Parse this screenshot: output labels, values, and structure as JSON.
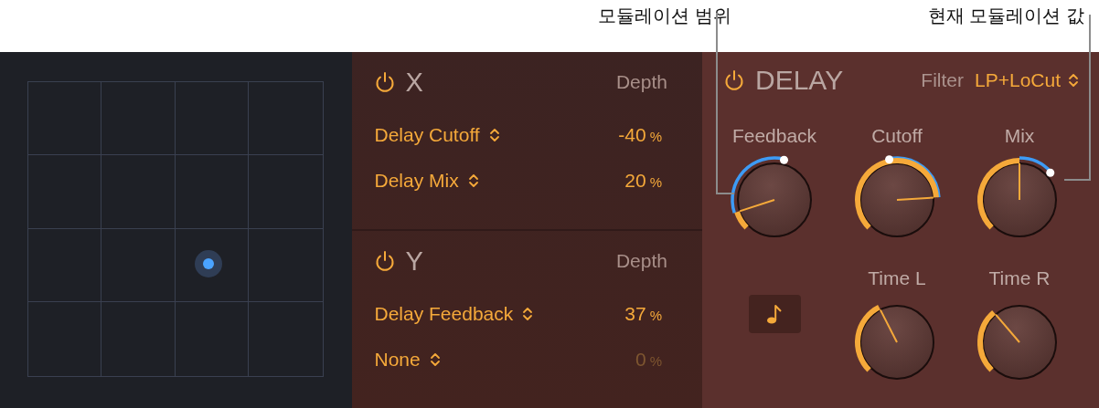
{
  "callouts": [
    {
      "text": "모듈레이션 범위"
    },
    {
      "text": "현재 모듈레이션 값"
    }
  ],
  "axes": [
    {
      "label": "X",
      "on": true,
      "depth_label": "Depth",
      "rows": [
        {
          "param": "Delay Cutoff",
          "value": "-40",
          "unit": "%",
          "active": true
        },
        {
          "param": "Delay Mix",
          "value": "20",
          "unit": "%",
          "active": true
        }
      ]
    },
    {
      "label": "Y",
      "on": true,
      "depth_label": "Depth",
      "rows": [
        {
          "param": "Delay Feedback",
          "value": "37",
          "unit": "%",
          "active": true
        },
        {
          "param": "None",
          "value": "0",
          "unit": "%",
          "active": false
        }
      ]
    }
  ],
  "delay": {
    "on": true,
    "title": "DELAY",
    "filter_label": "Filter",
    "filter_value": "LP+LoCut",
    "knobs": [
      {
        "label": "Feedback",
        "modulated": true
      },
      {
        "label": "Cutoff",
        "modulated": true
      },
      {
        "label": "Mix",
        "modulated": true
      },
      {
        "label": "Time L",
        "modulated": false
      },
      {
        "label": "Time R",
        "modulated": false
      }
    ]
  }
}
